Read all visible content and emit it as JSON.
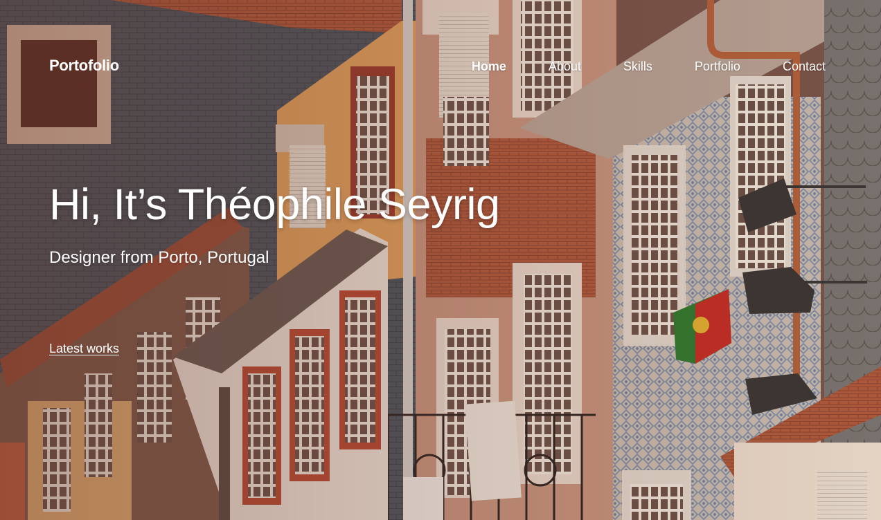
{
  "header": {
    "brand": "Portofolio",
    "nav": [
      {
        "label": "Home",
        "active": true
      },
      {
        "label": "About",
        "active": false
      },
      {
        "label": "Skills",
        "active": false
      },
      {
        "label": "Portfolio",
        "active": false
      },
      {
        "label": "Contact",
        "active": false
      }
    ]
  },
  "hero": {
    "title": "Hi, It’s Théophile Seyrig",
    "subtitle": "Designer from Porto, Portugal",
    "cta_label": "Latest works"
  },
  "colors": {
    "overlay_tint": "#6a3a30",
    "text": "#ffffff",
    "slate": "#4f5862",
    "ochre": "#e2a45e",
    "brick": "#a55238",
    "tile_blue": "#6f8fb7"
  },
  "background_image": "hero-photo"
}
